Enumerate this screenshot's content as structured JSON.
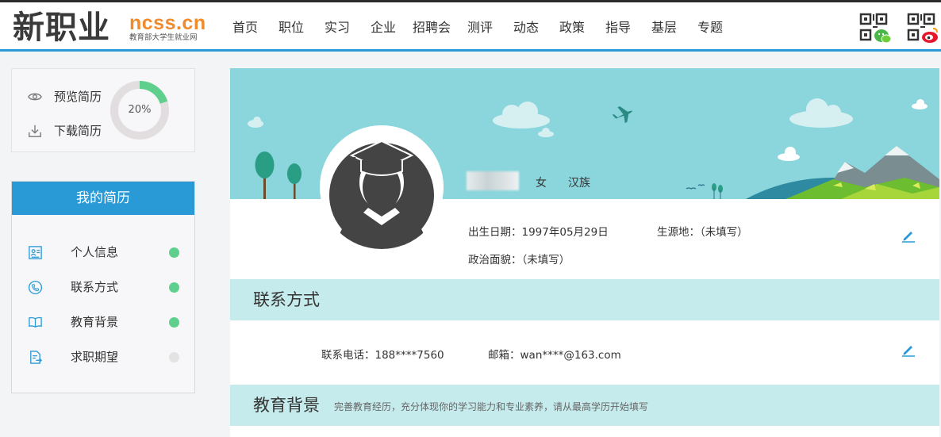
{
  "header": {
    "logo_cn": "新职业",
    "logo_en": "ncss.cn",
    "logo_sub": "教育部大学生就业网",
    "nav": [
      "首页",
      "职位",
      "实习",
      "企业",
      "招聘会",
      "测评",
      "动态",
      "政策",
      "指导",
      "基层",
      "专题"
    ],
    "qr_icons": [
      "wechat-qr-icon",
      "weibo-qr-icon"
    ]
  },
  "sidebar": {
    "preview_label": "预览简历",
    "download_label": "下载简历",
    "completion": "20%",
    "completion_value": 0.2,
    "resume_title": "我的简历",
    "items": [
      {
        "label": "个人信息",
        "icon": "id-card-icon",
        "status": "complete",
        "color": "#5fcf8e"
      },
      {
        "label": "联系方式",
        "icon": "phone-icon",
        "status": "complete",
        "color": "#5fcf8e"
      },
      {
        "label": "教育背景",
        "icon": "book-icon",
        "status": "complete",
        "color": "#5fcf8e"
      },
      {
        "label": "求职期望",
        "icon": "document-icon",
        "status": "incomplete",
        "color": "#e3e3e3"
      }
    ]
  },
  "profile": {
    "gender": "女",
    "ethnicity": "汉族",
    "birth_label": "出生日期：",
    "birth_value": "1997年05月29日",
    "origin_label": "生源地：",
    "origin_value": "（未填写）",
    "politics_label": "政治面貌：",
    "politics_value": "（未填写）"
  },
  "contact": {
    "title": "联系方式",
    "phone_label": "联系电话：",
    "phone_value": "188****7560",
    "email_label": "邮箱：",
    "email_value": "wan****@163.com"
  },
  "education": {
    "title": "教育背景",
    "hint": "完善教育经历，充分体现你的学习能力和专业素养，请从最高学历开始填写"
  },
  "colors": {
    "accent": "#2a9ad6",
    "section_bg": "#c6ebec",
    "banner_sky": "#8ad6dc",
    "status_green": "#5fcf8e"
  }
}
